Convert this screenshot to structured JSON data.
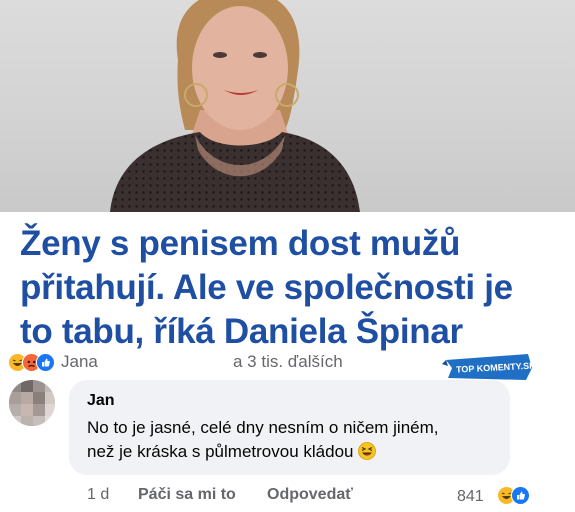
{
  "headline": {
    "lines": [
      "Ženy s penisem dost mužů",
      "přitahují. Ale ve společnosti je",
      "to tabu, říká Daniela Špinar"
    ]
  },
  "reactions": {
    "icons": [
      "laughing-emoji",
      "angry-emoji",
      "like-icon"
    ],
    "name": "Jana",
    "others": "a 3 tis. ďalších"
  },
  "badge": {
    "text": "TOP KOMENTY.SK"
  },
  "comment": {
    "author": "Jan",
    "lines": [
      "No to je jasné, celé dny nesním o ničem jiném,",
      "než je kráska s půlmetrovou kládou"
    ],
    "emoji": "laughing-squint-emoji",
    "time": "1 d",
    "like_label": "Páči sa mi to",
    "reply_label": "Odpovedať",
    "reaction_count": "841",
    "reaction_icons": [
      "laughing-emoji",
      "like-icon"
    ]
  },
  "colors": {
    "headline": "#1e4fa3",
    "secondary_text": "#65676b",
    "bubble": "#f0f2f5",
    "like_blue": "#1877f2",
    "angry_orange": "#f2673a",
    "emoji_yellow": "#f7b928"
  }
}
